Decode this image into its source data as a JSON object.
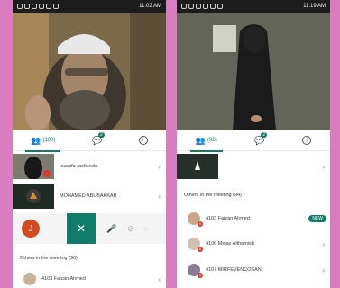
{
  "left": {
    "statusbar": {
      "time": "11:02 AM"
    },
    "tabs": {
      "participants_count": "100",
      "chat_badge": "2"
    },
    "pinned": [
      {
        "name": "huzaifa rasheeda"
      },
      {
        "name": "MOHAMED ABUBAKKAR"
      }
    ],
    "self_initial": "J",
    "others_header": "Others in the meeting (96)",
    "others": [
      {
        "name": "4103 Faizan Ahmed"
      }
    ]
  },
  "right": {
    "statusbar": {
      "time": "11:19 AM"
    },
    "tabs": {
      "participants_count": "98",
      "chat_badge": "2"
    },
    "others_header": "Others in the meeting (94)",
    "others": [
      {
        "name": "4103 Faizan Ahmed",
        "tag": "NEW"
      },
      {
        "name": "4106 Mejaz Althamish",
        "tag": ""
      },
      {
        "name": "4107 MIRFEVENCOSAN",
        "tag": ""
      }
    ]
  },
  "colors": {
    "accent": "#0f7d6a",
    "background": "#d97cc0",
    "badge_red": "#d93a2b"
  },
  "icons": [
    "people-icon",
    "chat-icon",
    "info-icon",
    "chevron-right-icon",
    "close-icon",
    "mic-icon",
    "camera-off-icon",
    "hand-icon"
  ]
}
